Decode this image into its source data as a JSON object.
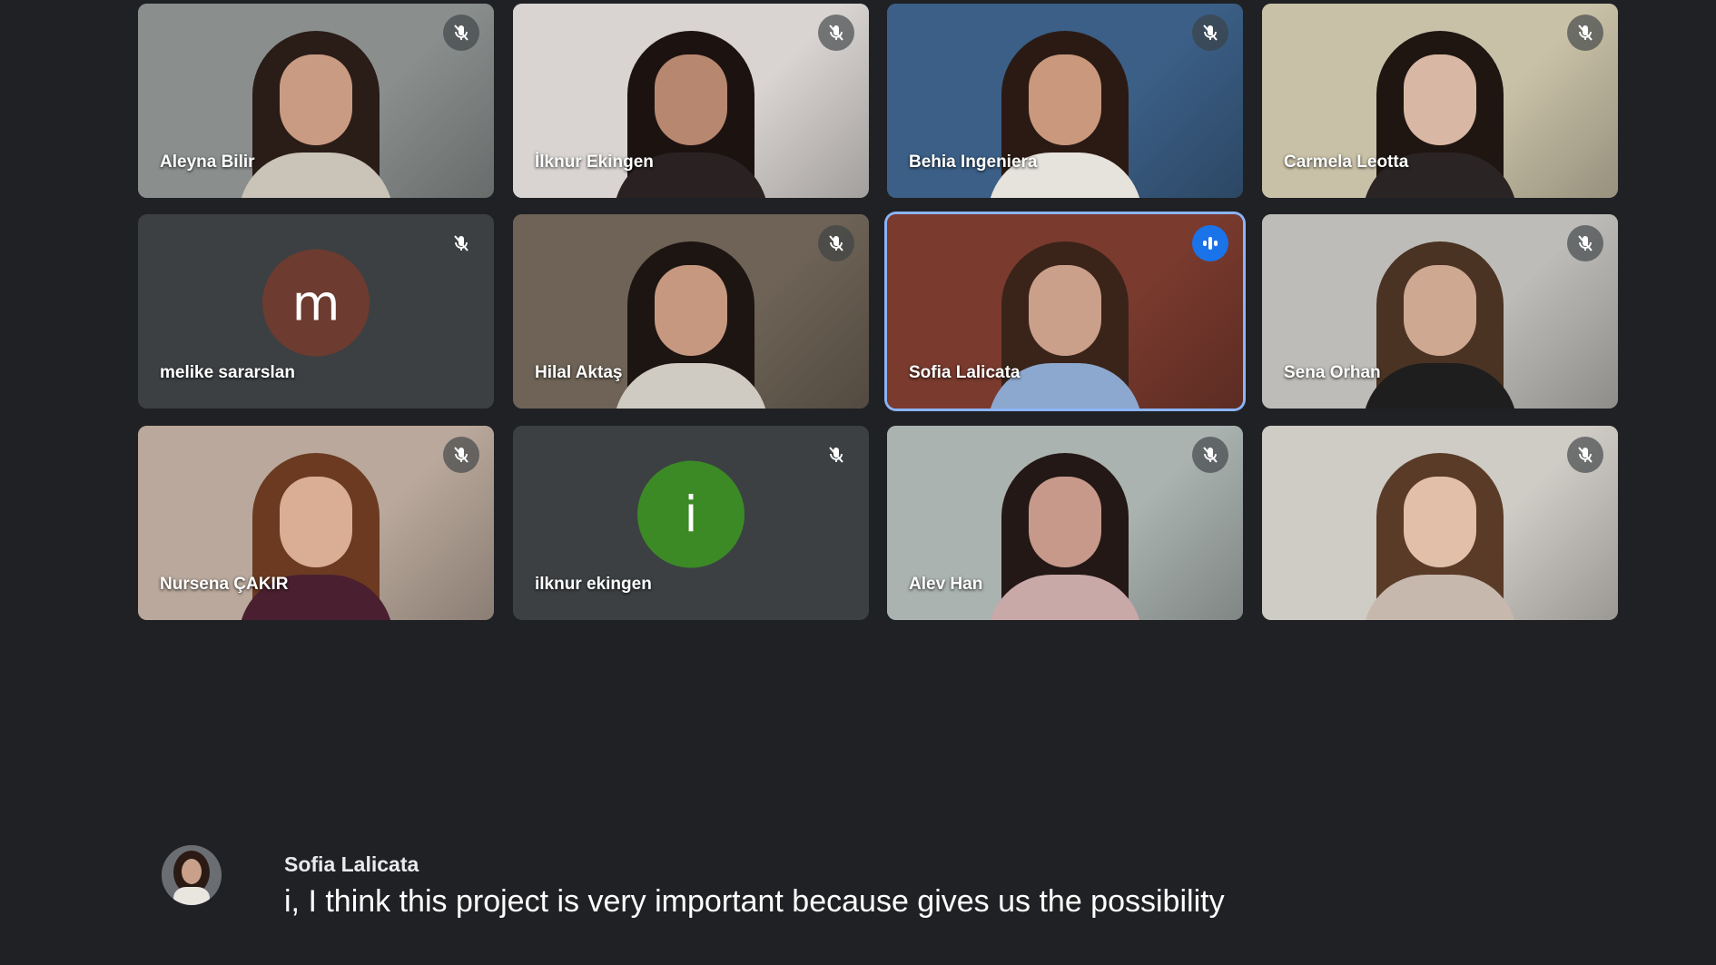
{
  "participants": [
    {
      "name": "Aleyna Bilir",
      "type": "video",
      "mic": "muted",
      "bg": "#8a8f8e",
      "hair": "#2a1c17",
      "skin": "#c99b82",
      "shirt": "#c9c3b8"
    },
    {
      "name": "İlknur Ekingen",
      "type": "video",
      "mic": "muted",
      "bg": "#d9d4d2",
      "hair": "#1c1311",
      "skin": "#b88770",
      "shirt": "#2a2222"
    },
    {
      "name": "Behia Ingeniera",
      "type": "video",
      "mic": "muted",
      "bg": "#3b5f86",
      "hair": "#2b1a14",
      "skin": "#c9987d",
      "shirt": "#e6e2dc"
    },
    {
      "name": "Carmela Leotta",
      "type": "video",
      "mic": "muted",
      "bg": "#c9c1a7",
      "hair": "#1f1612",
      "skin": "#d8b8a5",
      "shirt": "#2b2424"
    },
    {
      "name": "melike sararslan",
      "type": "avatar",
      "letter": "m",
      "avatar_color": "#6d3b2f",
      "mic": "muted"
    },
    {
      "name": "Hilal Aktaş",
      "type": "video",
      "mic": "muted",
      "bg": "#6e6356",
      "hair": "#1d1512",
      "skin": "#c79880",
      "shirt": "#cfcac2"
    },
    {
      "name": "Sofia Lalicata",
      "type": "video",
      "mic": "speaking",
      "active": true,
      "bg": "#7a3a2e",
      "hair": "#3a241a",
      "skin": "#caa08a",
      "shirt": "#8da8cf"
    },
    {
      "name": "Sena Orhan",
      "type": "video",
      "mic": "muted",
      "bg": "#bdbcb8",
      "hair": "#4a3322",
      "skin": "#cfa892",
      "shirt": "#1e1e1e"
    },
    {
      "name": "Nursena ÇAKIR",
      "type": "video",
      "mic": "muted",
      "bg": "#b9a89b",
      "hair": "#6b3a21",
      "skin": "#d9ae95",
      "shirt": "#4a2030"
    },
    {
      "name": "ilknur ekingen",
      "type": "avatar",
      "letter": "i",
      "avatar_color": "#3c8a25",
      "mic": "muted"
    },
    {
      "name": "Alev Han",
      "type": "video",
      "mic": "muted",
      "bg": "#aab3b0",
      "hair": "#231815",
      "skin": "#c7998a",
      "shirt": "#c9a8a8"
    },
    {
      "name": "",
      "type": "video",
      "mic": "muted",
      "bg": "#cfcbc5",
      "hair": "#5a3b27",
      "skin": "#e2bfa9",
      "shirt": "#c7b8ae"
    }
  ],
  "caption": {
    "speaker": "Sofia Lalicata",
    "text": "i, I think this project is very important because gives us the possibility"
  },
  "colors": {
    "background": "#202124",
    "tile": "#3c4043",
    "active_border": "#8ab4f8",
    "speaking_badge": "#1a73e8"
  }
}
